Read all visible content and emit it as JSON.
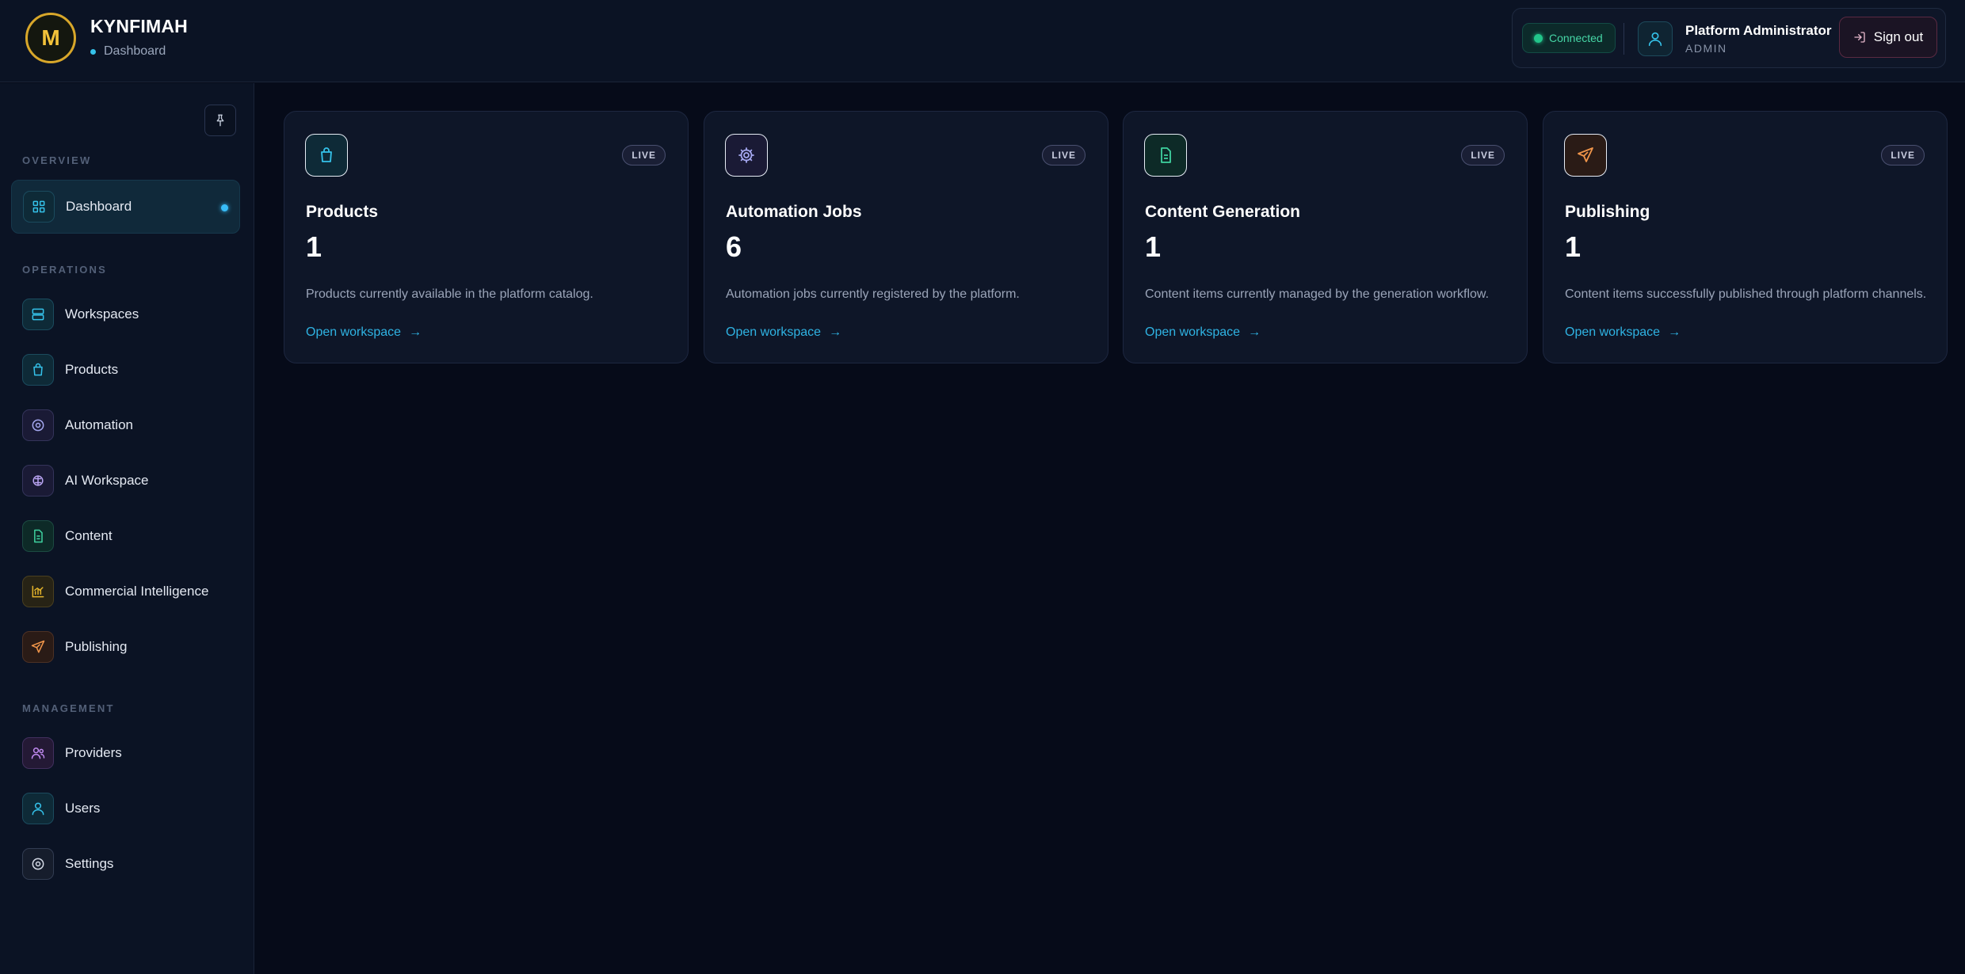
{
  "brand": {
    "logo_letter": "M",
    "name": "KYNFIMAH",
    "crumb": "Dashboard"
  },
  "session": {
    "status": "Connected",
    "user_name": "Platform Administrator",
    "user_role": "ADMIN",
    "signout_label": "Sign out"
  },
  "sidebar": {
    "sections": {
      "overview": "OVERVIEW",
      "operations": "OPERATIONS",
      "management": "MANAGEMENT"
    },
    "items": [
      {
        "label": "Dashboard",
        "icon": "grid-icon"
      },
      {
        "label": "Workspaces",
        "icon": "server-icon"
      },
      {
        "label": "Products",
        "icon": "shopping-bag-icon"
      },
      {
        "label": "Automation",
        "icon": "target-icon"
      },
      {
        "label": "AI Workspace",
        "icon": "brain-icon"
      },
      {
        "label": "Content",
        "icon": "document-icon"
      },
      {
        "label": "Commercial Intelligence",
        "icon": "bar-chart-icon"
      },
      {
        "label": "Publishing",
        "icon": "send-icon"
      },
      {
        "label": "Providers",
        "icon": "users-icon"
      },
      {
        "label": "Users",
        "icon": "user-icon"
      },
      {
        "label": "Settings",
        "icon": "settings-icon"
      }
    ]
  },
  "cards": [
    {
      "title": "Products",
      "value": "1",
      "badge": "LIVE",
      "description": "Products currently available in the platform catalog.",
      "link": "Open workspace",
      "arrow": "→",
      "icon": "shopping-bag-icon"
    },
    {
      "title": "Automation Jobs",
      "value": "6",
      "badge": "LIVE",
      "description": "Automation jobs currently registered by the platform.",
      "link": "Open workspace",
      "arrow": "→",
      "icon": "gear-icon"
    },
    {
      "title": "Content Generation",
      "value": "1",
      "badge": "LIVE",
      "description": "Content items currently managed by the generation workflow.",
      "link": "Open workspace",
      "arrow": "→",
      "icon": "document-icon"
    },
    {
      "title": "Publishing",
      "value": "1",
      "badge": "LIVE",
      "description": "Content items successfully published through platform channels.",
      "link": "Open workspace",
      "arrow": "→",
      "icon": "send-icon"
    }
  ],
  "colors": {
    "accent": "#35c2ea",
    "brand_gold": "#d8a72a",
    "status_green": "#22c58a",
    "background": "#060b19",
    "panel": "#0b1324"
  }
}
